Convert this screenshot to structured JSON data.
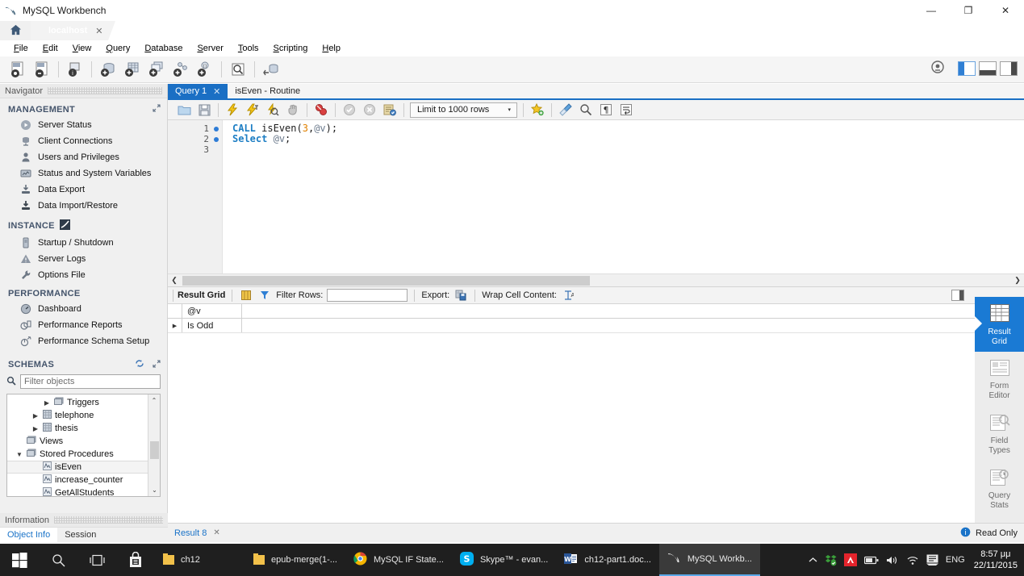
{
  "window": {
    "title": "MySQL Workbench",
    "app_icon": "mysql-dolphin-icon",
    "minimize": "—",
    "maximize": "❐",
    "close": "✕"
  },
  "connection_tabs": {
    "home_icon": "home-icon",
    "tabs": [
      {
        "label": "localhost",
        "close": "✕",
        "active": true
      }
    ]
  },
  "menubar": {
    "items": [
      {
        "label": "File",
        "accel": "F"
      },
      {
        "label": "Edit",
        "accel": "E"
      },
      {
        "label": "View",
        "accel": "V"
      },
      {
        "label": "Query",
        "accel": "Q"
      },
      {
        "label": "Database",
        "accel": "D"
      },
      {
        "label": "Server",
        "accel": "S"
      },
      {
        "label": "Tools",
        "accel": "T"
      },
      {
        "label": "Scripting",
        "accel": "S"
      },
      {
        "label": "Help",
        "accel": "H"
      }
    ]
  },
  "main_toolbar": {
    "buttons": [
      {
        "name": "new-sql-tab-icon",
        "glyph": "SQL"
      },
      {
        "name": "open-sql-script-icon",
        "glyph": "SQL"
      },
      {
        "name": "connection-info-icon",
        "glyph": "i"
      },
      {
        "name": "new-schema-icon",
        "glyph": "db+"
      },
      {
        "name": "new-table-icon",
        "glyph": "tbl+"
      },
      {
        "name": "new-view-icon",
        "glyph": "view+"
      },
      {
        "name": "new-procedure-icon",
        "glyph": "proc+"
      },
      {
        "name": "new-function-icon",
        "glyph": "fn+"
      },
      {
        "name": "search-data-icon",
        "glyph": "find"
      },
      {
        "name": "reconnect-server-icon",
        "glyph": "conn"
      }
    ],
    "right_icons": [
      {
        "name": "workbench-logo-icon"
      },
      {
        "name": "toggle-sidebar-icon",
        "active": true
      },
      {
        "name": "toggle-output-icon",
        "active": false
      },
      {
        "name": "toggle-secondary-sidebar-icon",
        "active": false
      }
    ]
  },
  "navigator": {
    "header": "Navigator",
    "sections": [
      {
        "title": "MANAGEMENT",
        "expand_icon": "expand-icon",
        "items": [
          {
            "label": "Server Status",
            "icon": "server-status-icon"
          },
          {
            "label": "Client Connections",
            "icon": "client-connections-icon"
          },
          {
            "label": "Users and Privileges",
            "icon": "users-privileges-icon"
          },
          {
            "label": "Status and System Variables",
            "icon": "status-variables-icon"
          },
          {
            "label": "Data Export",
            "icon": "data-export-icon"
          },
          {
            "label": "Data Import/Restore",
            "icon": "data-import-icon"
          }
        ]
      },
      {
        "title": "INSTANCE",
        "badge_icon": "instance-icon",
        "items": [
          {
            "label": "Startup / Shutdown",
            "icon": "startup-shutdown-icon"
          },
          {
            "label": "Server Logs",
            "icon": "server-logs-icon"
          },
          {
            "label": "Options File",
            "icon": "options-file-icon"
          }
        ]
      },
      {
        "title": "PERFORMANCE",
        "items": [
          {
            "label": "Dashboard",
            "icon": "dashboard-icon"
          },
          {
            "label": "Performance Reports",
            "icon": "performance-reports-icon"
          },
          {
            "label": "Performance Schema Setup",
            "icon": "performance-schema-icon"
          }
        ]
      }
    ],
    "schemas": {
      "title": "SCHEMAS",
      "refresh_icon": "refresh-icon",
      "expand_icon": "expand-icon",
      "filter_placeholder": "Filter objects",
      "filter_value": "",
      "search_icon": "search-icon",
      "tree": [
        {
          "label": "Triggers",
          "icon": "triggers-icon",
          "indent": 3,
          "arrow": "▶",
          "selected": false
        },
        {
          "label": "telephone",
          "icon": "table-icon",
          "indent": 2,
          "arrow": "▶",
          "selected": false
        },
        {
          "label": "thesis",
          "icon": "table-icon",
          "indent": 2,
          "arrow": "▶",
          "selected": false
        },
        {
          "label": "Views",
          "icon": "views-icon",
          "indent": 1,
          "arrow": "",
          "selected": false
        },
        {
          "label": "Stored Procedures",
          "icon": "procedures-icon",
          "indent": 1,
          "arrow": "▼",
          "selected": false
        },
        {
          "label": "isEven",
          "icon": "routine-icon",
          "indent": 3,
          "arrow": "",
          "selected": true
        },
        {
          "label": "increase_counter",
          "icon": "routine-icon",
          "indent": 3,
          "arrow": "",
          "selected": false
        },
        {
          "label": "GetAllStudents",
          "icon": "routine-icon",
          "indent": 3,
          "arrow": "",
          "selected": false
        }
      ],
      "scroll_up": "⌃",
      "scroll_down": "⌄"
    }
  },
  "information_pane": {
    "header": "Information",
    "tabs": [
      {
        "label": "Object Info",
        "active": true
      },
      {
        "label": "Session",
        "active": false
      }
    ]
  },
  "editor": {
    "tabs": [
      {
        "label": "Query 1",
        "close": "✕",
        "active": true
      },
      {
        "label": "isEven - Routine",
        "close": "",
        "active": false
      }
    ],
    "toolbar": {
      "buttons": [
        {
          "name": "open-script-icon"
        },
        {
          "name": "save-script-icon"
        },
        {
          "name": "execute-statement-icon"
        },
        {
          "name": "execute-current-statement-icon"
        },
        {
          "name": "explain-query-icon"
        },
        {
          "name": "stop-query-icon"
        },
        {
          "name": "toggle-stop-on-error-icon"
        },
        {
          "name": "commit-transaction-icon"
        },
        {
          "name": "rollback-transaction-icon"
        },
        {
          "name": "toggle-autocommit-icon"
        }
      ],
      "limit_label": "Limit to 1000 rows",
      "limit_arrow": "▾",
      "right_buttons": [
        {
          "name": "add-snippet-icon"
        },
        {
          "name": "beautify-query-icon"
        },
        {
          "name": "find-icon"
        },
        {
          "name": "toggle-invisible-chars-icon"
        },
        {
          "name": "toggle-word-wrap-icon"
        }
      ]
    },
    "gutter_lines": [
      {
        "num": "1",
        "marker": true
      },
      {
        "num": "2",
        "marker": true
      },
      {
        "num": "3",
        "marker": false
      }
    ],
    "code": {
      "line1": {
        "kw": "CALL",
        "fn": "isEven",
        "open": "(",
        "num": "3",
        "comma": ",",
        "var": "@v",
        "close": ");"
      },
      "line2": {
        "kw": "Select",
        "var": "@v",
        "semi": ";"
      }
    },
    "hscroll": {
      "left_arrow": "❮",
      "right_arrow": "❯"
    }
  },
  "results": {
    "toolbar": {
      "title": "Result Grid",
      "filter_label": "Filter Rows:",
      "filter_value": "",
      "export_label": "Export:",
      "wrap_label": "Wrap Cell Content:",
      "grid_icon": "grid-view-icon",
      "filter_icon": "filter-icon",
      "export_icon": "export-icon",
      "wrap_icon": "wrap-cell-icon",
      "panel_toggle_icon": "toggle-panel-icon"
    },
    "columns": [
      "@v"
    ],
    "rows": [
      {
        "marker": "▶",
        "cells": [
          "Is Odd"
        ]
      }
    ]
  },
  "right_strip": {
    "items": [
      {
        "label": "Result\nGrid",
        "line1": "Result",
        "line2": "Grid",
        "icon": "result-grid-icon",
        "active": true
      },
      {
        "label": "Form Editor",
        "line1": "Form",
        "line2": "Editor",
        "icon": "form-editor-icon",
        "active": false
      },
      {
        "label": "Field Types",
        "line1": "Field",
        "line2": "Types",
        "icon": "field-types-icon",
        "active": false
      },
      {
        "label": "Query Stats",
        "line1": "Query",
        "line2": "Stats",
        "icon": "query-stats-icon",
        "active": false
      }
    ],
    "more_arrow": "⌄"
  },
  "statusbar": {
    "result_label": "Result 8",
    "result_close": "✕",
    "info_icon": "info-icon",
    "readonly_label": "Read Only"
  },
  "taskbar": {
    "start_icon": "windows-start-icon",
    "search_icon": "search-icon",
    "taskview_icon": "task-view-icon",
    "store_icon": "store-icon",
    "apps": [
      {
        "label": "ch12",
        "icon": "folder-icon",
        "active": false
      },
      {
        "label": "epub-merge(1-...",
        "icon": "folder-icon",
        "active": false
      },
      {
        "label": "MySQL IF State...",
        "icon": "chrome-icon",
        "active": false
      },
      {
        "label": "Skype™ - evan...",
        "icon": "skype-icon",
        "active": false
      },
      {
        "label": "ch12-part1.doc...",
        "icon": "word-icon",
        "active": false
      },
      {
        "label": "MySQL Workb...",
        "icon": "mysql-dolphin-icon",
        "active": true
      }
    ],
    "tray": [
      {
        "name": "show-hidden-icons",
        "glyph": "⌃"
      },
      {
        "name": "dropbox-icon",
        "glyph": ""
      },
      {
        "name": "avira-icon",
        "glyph": ""
      },
      {
        "name": "battery-icon",
        "glyph": ""
      },
      {
        "name": "volume-icon",
        "glyph": ""
      },
      {
        "name": "wifi-icon",
        "glyph": ""
      },
      {
        "name": "action-center-icon",
        "glyph": ""
      }
    ],
    "language": "ENG",
    "time": "8:57 μμ",
    "date": "22/11/2015"
  },
  "colors": {
    "accent_blue": "#1a6fc4",
    "strip_active": "#1a7ad4",
    "keyword": "#1d7ec4",
    "number": "#e08000",
    "variable": "#6b7a8c",
    "section_title": "#44546b",
    "taskbar_bg": "#1f1f1f"
  }
}
